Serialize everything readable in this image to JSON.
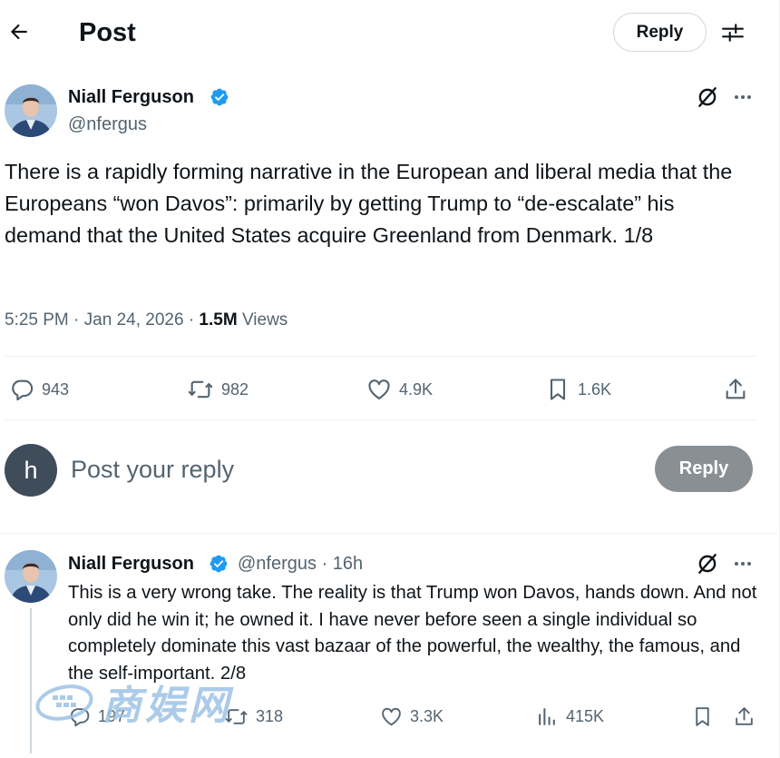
{
  "header": {
    "title": "Post",
    "reply_label": "Reply"
  },
  "post": {
    "author_name": "Niall Ferguson",
    "author_handle": "@nfergus",
    "text": "There is a rapidly forming narrative in the European and liberal media that the Europeans “won Davos”: primarily by getting Trump to “de-escalate” his demand that the United States acquire Greenland from Denmark. 1/8",
    "time": "5:25 PM",
    "date": "Jan 24, 2026",
    "views_count": "1.5M",
    "views_label": "Views",
    "replies": "943",
    "reposts": "982",
    "likes": "4.9K",
    "bookmarks": "1.6K"
  },
  "compose": {
    "avatar_letter": "h",
    "placeholder": "Post your reply",
    "button_label": "Reply"
  },
  "reply": {
    "author_name": "Niall Ferguson",
    "author_handle": "@nfergus",
    "time_ago": "16h",
    "text": "This is a very wrong take. The reality is that Trump won Davos, hands down. And not only did he win it; he owned it. I have never before seen a single individual so completely dominate this vast bazaar of the powerful, the wealthy, the famous, and the self-important. 2/8",
    "replies": "197",
    "reposts": "318",
    "likes": "3.3K",
    "views": "415K"
  },
  "watermark": {
    "text": "商娱网"
  },
  "colors": {
    "verified_blue": "#1d9bf0",
    "text_primary": "#0f1419",
    "text_secondary": "#536471",
    "divider": "#eff3f4",
    "disabled_button": "#8a8f93"
  },
  "icons": {
    "back": "arrow-left-icon",
    "settings": "sliders-icon",
    "verified": "verified-badge-icon",
    "grok": "grok-icon",
    "more": "more-icon",
    "reply": "comment-icon",
    "repost": "repost-icon",
    "like": "heart-icon",
    "bookmark": "bookmark-icon",
    "share": "share-icon",
    "views": "analytics-icon"
  }
}
